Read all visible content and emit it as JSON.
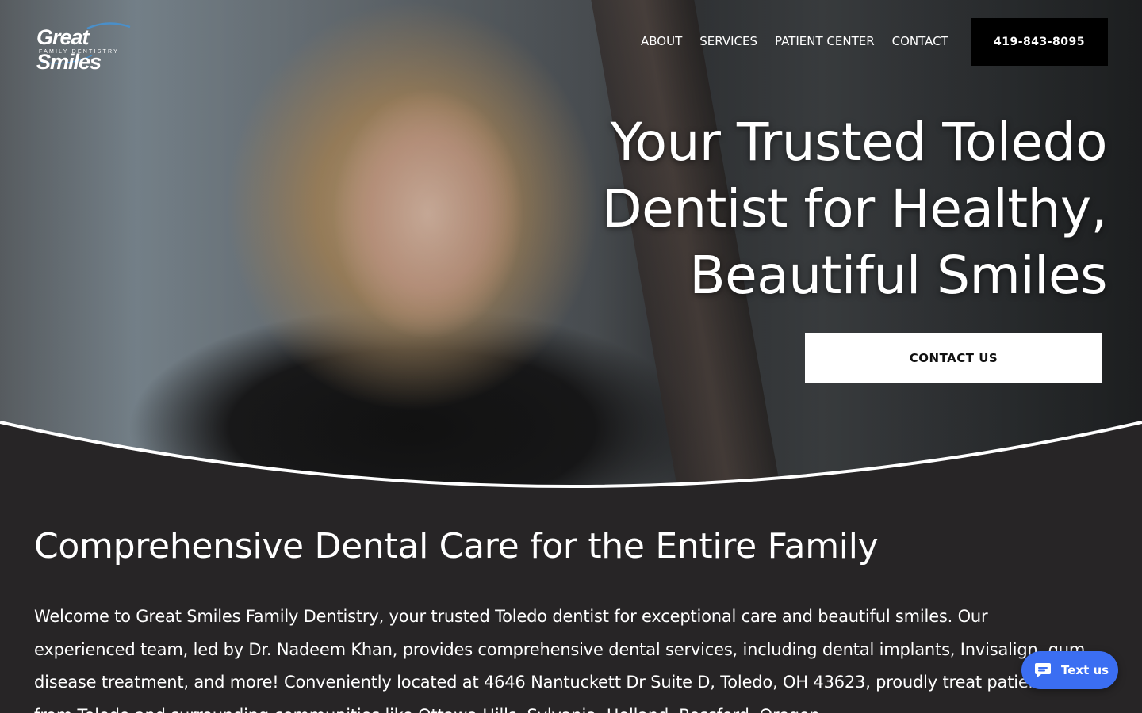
{
  "brand": {
    "logo_text": "Great Smiles",
    "logo_subtext": "FAMILY DENTISTRY"
  },
  "nav": {
    "items": [
      {
        "label": "ABOUT"
      },
      {
        "label": "SERVICES"
      },
      {
        "label": "PATIENT CENTER"
      },
      {
        "label": "CONTACT"
      }
    ],
    "phone": "419-843-8095"
  },
  "hero": {
    "title_line1": "Your Trusted Toledo",
    "title_line2": "Dentist for Healthy,",
    "title_line3": "Beautiful Smiles",
    "cta_label": "CONTACT US"
  },
  "main": {
    "heading": "Comprehensive Dental Care for the Entire Family",
    "paragraph": "Welcome to Great Smiles Family Dentistry, your trusted Toledo dentist for exceptional care and beautiful smiles. Our experienced team, led by Dr. Nadeem Khan, provides comprehensive dental services, including dental implants, Invisalign, gum disease treatment, and more! Conveniently located at 4646 Nantuckett Dr Suite D, Toledo, OH 43623, proudly treat patients from Toledo and surrounding communities like Ottawa Hills, Sylvania, Holland, Rossford, Oregon"
  },
  "chat_widget": {
    "label": "Text us",
    "icon": "chat-bubble-icon",
    "color": "#3b6ef2"
  },
  "colors": {
    "page_background": "#272526",
    "phone_button": "#000000",
    "cta_button": "#ffffff"
  }
}
